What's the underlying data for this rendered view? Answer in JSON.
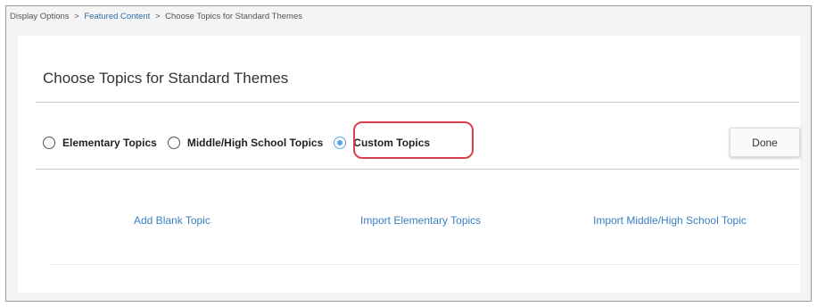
{
  "breadcrumb": {
    "item1": "Display Options",
    "sep1": ">",
    "item2": "Featured Content",
    "sep2": ">",
    "item3": "Choose Topics for Standard Themes"
  },
  "page": {
    "title": "Choose Topics for Standard Themes"
  },
  "topic_options": [
    {
      "label": "Elementary Topics",
      "selected": false
    },
    {
      "label": "Middle/High School Topics",
      "selected": false
    },
    {
      "label": "Custom Topics",
      "selected": true
    }
  ],
  "done_button": {
    "label": "Done"
  },
  "actions": {
    "add_blank": "Add Blank Topic",
    "import_elementary": "Import Elementary Topics",
    "import_middle_high": "Import Middle/High School Topic"
  },
  "colors": {
    "link": "#3a7fc0",
    "radio_selected": "#5aa4e0",
    "highlight": "#d9414f"
  }
}
